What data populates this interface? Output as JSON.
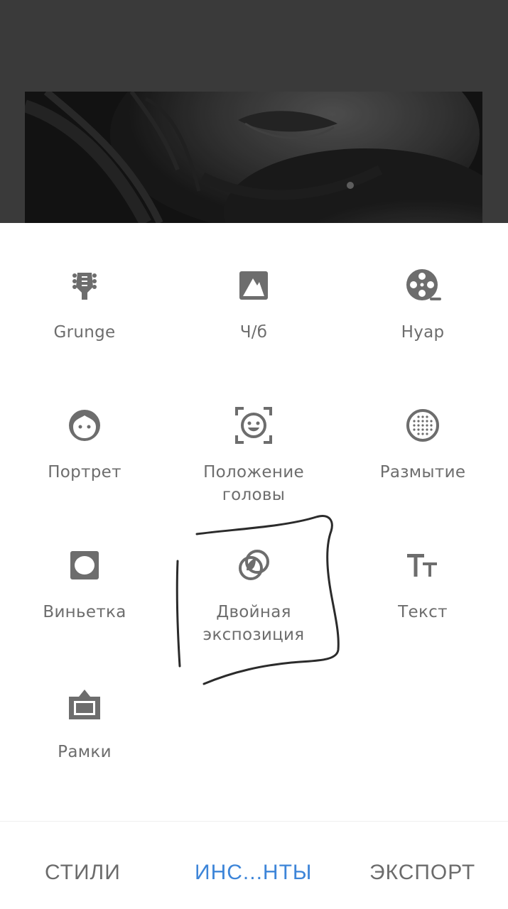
{
  "tools": [
    {
      "name": "grunge",
      "label": "Grunge",
      "icon": "guitar-head-icon"
    },
    {
      "name": "bw",
      "label": "Ч/б",
      "icon": "black-white-icon"
    },
    {
      "name": "noir",
      "label": "Нуар",
      "icon": "film-reel-icon"
    },
    {
      "name": "portrait",
      "label": "Портрет",
      "icon": "face-icon"
    },
    {
      "name": "head-pose",
      "label": "Положение\nголовы",
      "icon": "face-frame-icon"
    },
    {
      "name": "blur",
      "label": "Размытие",
      "icon": "blur-dots-icon"
    },
    {
      "name": "vignette",
      "label": "Виньетка",
      "icon": "vignette-icon"
    },
    {
      "name": "double-exposure",
      "label": "Двойная\nэкспозиция",
      "icon": "double-circle-icon"
    },
    {
      "name": "text",
      "label": "Текст",
      "icon": "text-tt-icon"
    },
    {
      "name": "frames",
      "label": "Рамки",
      "icon": "frame-icon"
    }
  ],
  "tabs": {
    "styles": "СТИЛИ",
    "tools": "ИНС...НТЫ",
    "export": "ЭКСПОРТ"
  },
  "colors": {
    "accent": "#3d85d8",
    "icon": "#6d6d6d",
    "preview_bg": "#3a3a3a"
  }
}
